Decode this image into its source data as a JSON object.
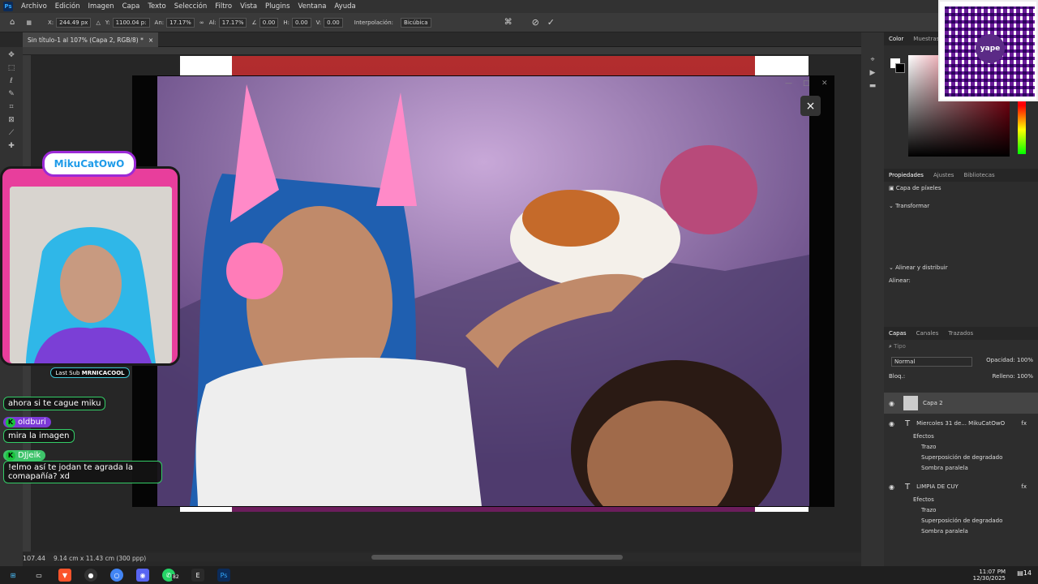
{
  "app": {
    "name": "Adobe Photoshop",
    "logo": "Ps"
  },
  "menu": [
    "Archivo",
    "Edición",
    "Imagen",
    "Capa",
    "Texto",
    "Selección",
    "Filtro",
    "Vista",
    "Plugins",
    "Ventana",
    "Ayuda"
  ],
  "options": {
    "x_label": "X:",
    "x_value": "244.49 px",
    "y_label": "Y:",
    "y_value": "1100.04 p:",
    "w_label": "An:",
    "w_value": "17.17%",
    "h_label": "Al:",
    "h_value": "17.17%",
    "angle_value": "0.00",
    "hskew_label": "H:",
    "hskew_value": "0.00",
    "vskew_label": "V:",
    "vskew_value": "0.00",
    "interp_label": "Interpolación:",
    "interp_value": "Bicúbica"
  },
  "document": {
    "tab_title": "Sin título-1 al 107% (Capa 2, RGB/8) *"
  },
  "status": {
    "zoom": "107.44",
    "size": "9.14 cm x 11.43 cm (300 ppp)"
  },
  "right_panel": {
    "color_tabs": [
      "Color",
      "Muestras"
    ],
    "prop_tabs": [
      "Propiedades",
      "Ajustes",
      "Bibliotecas"
    ],
    "layer_type": "Capa de píxeles",
    "transform_title": "Transformar",
    "align_title": "Alinear y distribuir",
    "align_label": "Alinear:",
    "layers_tabs": [
      "Capas",
      "Canales",
      "Trazados"
    ],
    "search_placeholder": "Tipo",
    "blend_mode": "Normal",
    "opacity_label": "Opacidad:",
    "opacity_value": "100%",
    "lock_label": "Bloq.:",
    "fill_label": "Relleno:",
    "fill_value": "100%",
    "layers": [
      {
        "name": "Capa 2"
      },
      {
        "name": "Miercoles 31 de... MikuCatOwO",
        "fx": "fx",
        "effects_label": "Efectos",
        "effects": [
          "Trazo",
          "Superposición de degradado",
          "Sombra paralela"
        ]
      },
      {
        "name": "LIMPIA DE CUY",
        "fx": "fx",
        "effects_label": "Efectos",
        "effects": [
          "Trazo",
          "Superposición de degradado",
          "Sombra paralela"
        ]
      }
    ]
  },
  "stream_overlay": {
    "channel_name": "MikuCatOwO",
    "last_sub_label": "Last Sub",
    "last_sub_name": "MRNICACOOL",
    "chat": [
      {
        "user": "",
        "text": "ahora si te cague miku"
      },
      {
        "user": "oldburi",
        "text": "mira la imagen"
      },
      {
        "user": "DJjeik",
        "text": "!elmo así te jodan te agrada la comapañía? xd"
      }
    ],
    "qr_brand": "yape"
  },
  "taskbar": {
    "time": "11:07 PM",
    "date": "12/30/2025",
    "whatsapp_badge": "82",
    "notif_badge": "14"
  },
  "colors": {
    "accent": "#31a8ff",
    "stream_pink": "#e83e9c",
    "chat_badge": "#1ac33c"
  }
}
